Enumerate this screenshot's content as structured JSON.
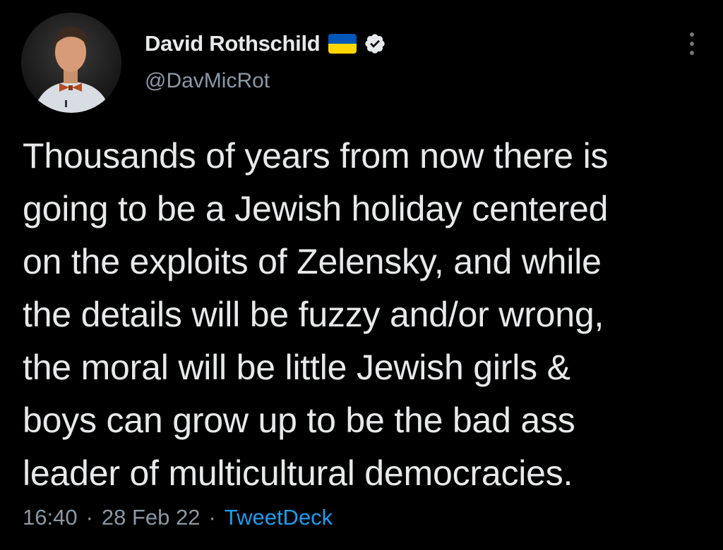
{
  "author": {
    "display_name": "David Rothschild",
    "handle": "@DavMicRot",
    "avatar_icon": "profile-photo",
    "badges": [
      "ukraine-flag-icon",
      "verified-icon"
    ],
    "verified_color": "#e7e9ea"
  },
  "tweet": {
    "text": "Thousands of years from now there is\ngoing to be a Jewish holiday centered\non the exploits of Zelensky, and while\nthe details will be fuzzy and/or wrong,\nthe moral will be little Jewish girls &\nboys can grow up to be the bad ass\nleader of multicultural democracies."
  },
  "meta": {
    "time": "16:40",
    "separator": "·",
    "date": "28 Feb 22",
    "source": "TweetDeck"
  },
  "colors": {
    "background": "#000000",
    "primary_text": "#e7e9ea",
    "secondary_text": "#8b98a5",
    "link": "#1d9bf0",
    "flag_blue": "#0057b7",
    "flag_yellow": "#ffd700"
  }
}
